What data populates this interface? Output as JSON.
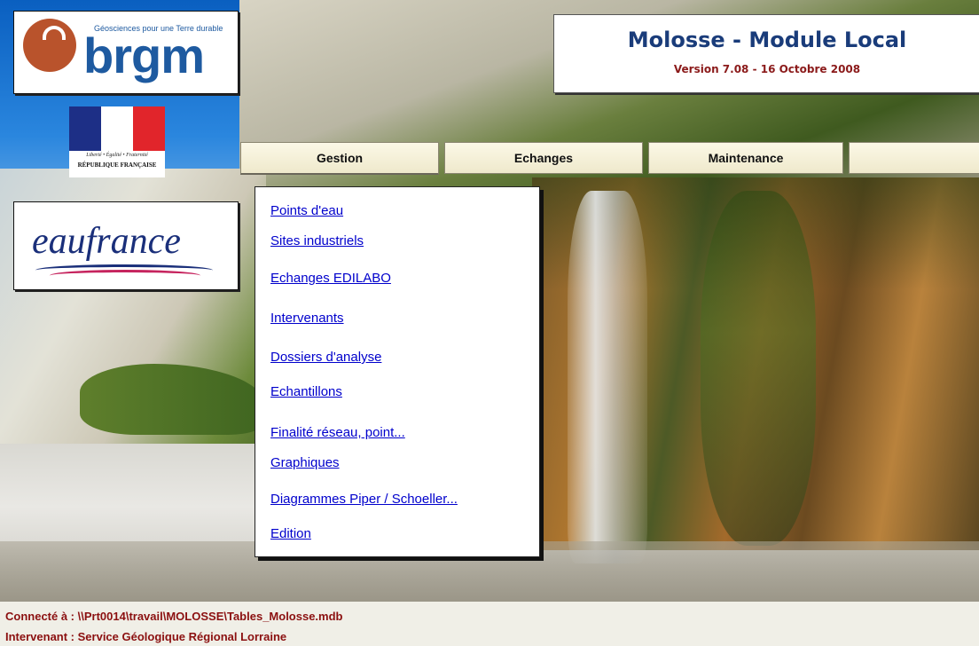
{
  "brgm_logo": {
    "wordmark": "brgm",
    "tagline": "Géosciences pour une Terre durable"
  },
  "republique_logo": {
    "motto": "Liberté • Égalité • Fraternité",
    "name": "RÉPUBLIQUE FRANÇAISE"
  },
  "eaufrance_logo": {
    "wordmark": "eaufrance"
  },
  "header": {
    "title": "Molosse - Module Local",
    "version": "Version 7.08 -  16 Octobre 2008"
  },
  "menubar": {
    "tabs": [
      {
        "label": "Gestion"
      },
      {
        "label": "Echanges"
      },
      {
        "label": "Maintenance"
      },
      {
        "label": ""
      }
    ],
    "active_tab": "Gestion"
  },
  "gestion_menu": {
    "items": [
      {
        "label": "Points d'eau"
      },
      {
        "label": "Sites industriels"
      },
      {
        "label": "Echanges EDILABO"
      },
      {
        "label": "Intervenants"
      },
      {
        "label": "Dossiers d'analyse"
      },
      {
        "label": "Echantillons"
      },
      {
        "label": "Finalité réseau, point..."
      },
      {
        "label": "Graphiques"
      },
      {
        "label": "Diagrammes Piper / Schoeller..."
      },
      {
        "label": "Edition"
      }
    ]
  },
  "status": {
    "connection": "Connecté à : \\\\Prt0014\\travail\\MOLOSSE\\Tables_Molosse.mdb",
    "intervenant": "Intervenant : Service Géologique Régional Lorraine"
  },
  "colors": {
    "link": "#0000cc",
    "status_text": "#8b1010",
    "title_text": "#1a3c7a",
    "version_text": "#8b1a1a",
    "brgm_blue": "#1e5aa0",
    "brgm_orange": "#b9532c"
  }
}
